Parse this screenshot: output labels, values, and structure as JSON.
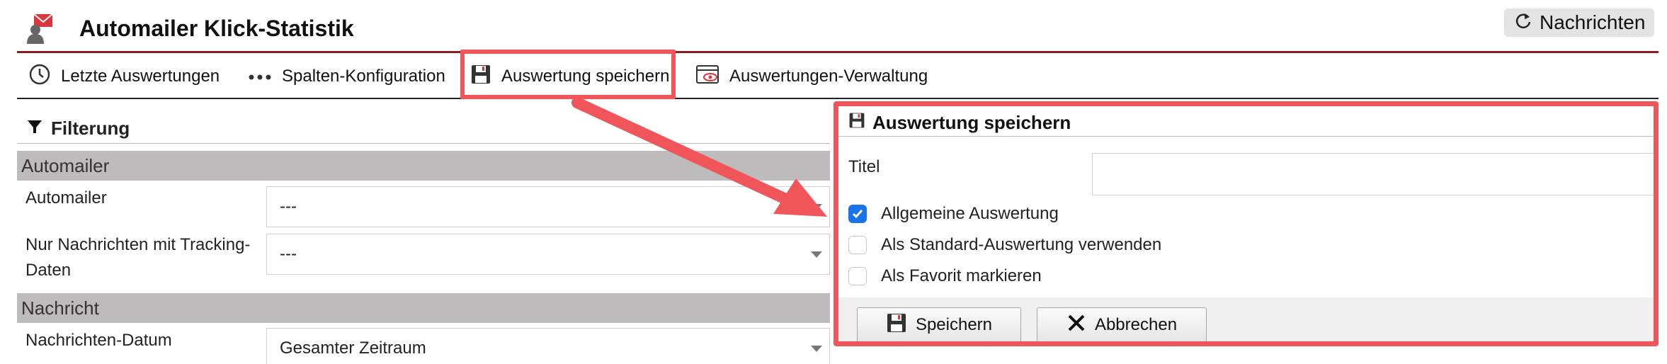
{
  "header": {
    "title": "Automailer Klick-Statistik",
    "nachrichten_button": "Nachrichten"
  },
  "toolbar": {
    "items": [
      {
        "label": "Letzte Auswertungen",
        "icon": "clock-icon"
      },
      {
        "label": "Spalten-Konfiguration",
        "icon": "dots-icon"
      },
      {
        "label": "Auswertung speichern",
        "icon": "floppy-disk-icon"
      },
      {
        "label": "Auswertungen-Verwaltung",
        "icon": "window-eye-icon"
      }
    ]
  },
  "filter": {
    "title": "Filterung",
    "sections": [
      {
        "name": "Automailer"
      },
      {
        "name": "Nachricht"
      }
    ],
    "fields": [
      {
        "label": "Automailer",
        "value": "---"
      },
      {
        "label_line1": "Nur Nachrichten mit Tracking-",
        "label_line2": "Daten",
        "value": "---"
      },
      {
        "label": "Nachrichten-Datum",
        "value": "Gesamter Zeitraum"
      }
    ]
  },
  "dialog": {
    "title": "Auswertung speichern",
    "title_label": "Titel",
    "title_value": "",
    "options": [
      {
        "label": "Allgemeine Auswertung",
        "checked": true
      },
      {
        "label": "Als Standard-Auswertung verwenden",
        "checked": false
      },
      {
        "label": "Als Favorit markieren",
        "checked": false
      }
    ],
    "save_button": "Speichern",
    "cancel_button": "Abbrechen"
  },
  "colors": {
    "accent_red": "#8f1d1d",
    "highlight": "#f0555a",
    "section_gray": "#bdbbbc",
    "checkbox_blue": "#1a73e8"
  }
}
